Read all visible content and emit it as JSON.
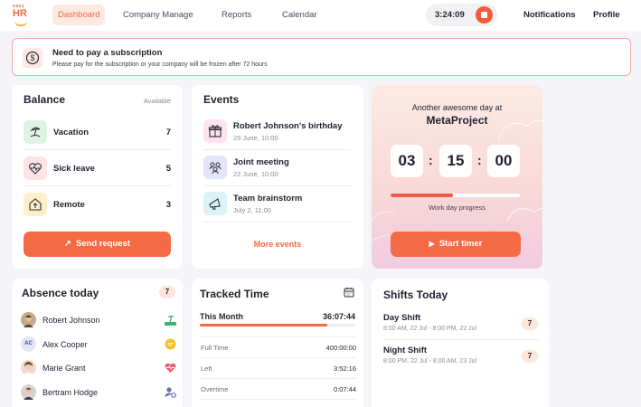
{
  "brand": {
    "logo_top": "easy",
    "logo_main": "HR",
    "accent": "#f26a3f"
  },
  "nav": {
    "items": [
      {
        "label": "Dashboard",
        "active": true
      },
      {
        "label": "Company Manage",
        "active": false
      },
      {
        "label": "Reports",
        "active": false
      },
      {
        "label": "Calendar",
        "active": false
      }
    ],
    "timer": "3:24:09",
    "notifications": "Notifications",
    "profile": "Profile"
  },
  "alert": {
    "title": "Need to pay a subscription",
    "message": "Please pay for the subscription or your company will be frozen after 72 hours",
    "icon": "dollar-icon"
  },
  "balance": {
    "title": "Balance",
    "available_label": "Available",
    "items": [
      {
        "label": "Vacation",
        "value": "7",
        "icon": "beach-icon",
        "color": "#dff3e3"
      },
      {
        "label": "Sick leave",
        "value": "5",
        "icon": "heart-pulse-icon",
        "color": "#fde3e6"
      },
      {
        "label": "Remote",
        "value": "3",
        "icon": "home-icon",
        "color": "#fdf0c9"
      }
    ],
    "button": "Send request"
  },
  "events": {
    "title": "Events",
    "items": [
      {
        "name": "Robert Johnson's birthday",
        "date": "29 June, 10:00",
        "icon": "gift-icon",
        "color": "#fde3ee"
      },
      {
        "name": "Joint meeting",
        "date": "22 June, 10:00",
        "icon": "people-icon",
        "color": "#e3e6fb"
      },
      {
        "name": "Team brainstorm",
        "date": "July 2, 11:00",
        "icon": "megaphone-icon",
        "color": "#daf3f6"
      }
    ],
    "more": "More events"
  },
  "timer_card": {
    "line1": "Another awesome day at",
    "line2": "MetaProject",
    "hours": "03",
    "minutes": "15",
    "seconds": "00",
    "progress": 0.48,
    "progress_label": "Work day progress",
    "button": "Start timer"
  },
  "absence": {
    "title": "Absence today",
    "count": "7",
    "people": [
      {
        "name": "Robert Johnson",
        "status_icon": "beach-icon",
        "avatar": "photo"
      },
      {
        "name": "Alex Cooper",
        "status_icon": "chat-icon",
        "avatar_initials": "AC"
      },
      {
        "name": "Marie Grant",
        "status_icon": "heart-pulse-icon",
        "avatar": "photo"
      },
      {
        "name": "Bertram Hodge",
        "status_icon": "user-settings-icon",
        "avatar": "photo"
      }
    ]
  },
  "tracked": {
    "title": "Tracked Time",
    "month_label": "This Month",
    "month_value": "36:07:44",
    "month_progress": 0.82,
    "rows": [
      {
        "label": "Full Time",
        "value": "400:00:00"
      },
      {
        "label": "Left",
        "value": "3:52:16"
      },
      {
        "label": "Overtime",
        "value": "0:07:44"
      }
    ]
  },
  "shifts": {
    "title": "Shifts Today",
    "items": [
      {
        "name": "Day Shift",
        "time": "8:00 AM, 22 Jul - 8:00 PM, 22 Jul",
        "count": "7"
      },
      {
        "name": "Night Shift",
        "time": "8:00 PM, 22 Jul - 8:00 AM, 23 Jul",
        "count": "7"
      }
    ]
  }
}
